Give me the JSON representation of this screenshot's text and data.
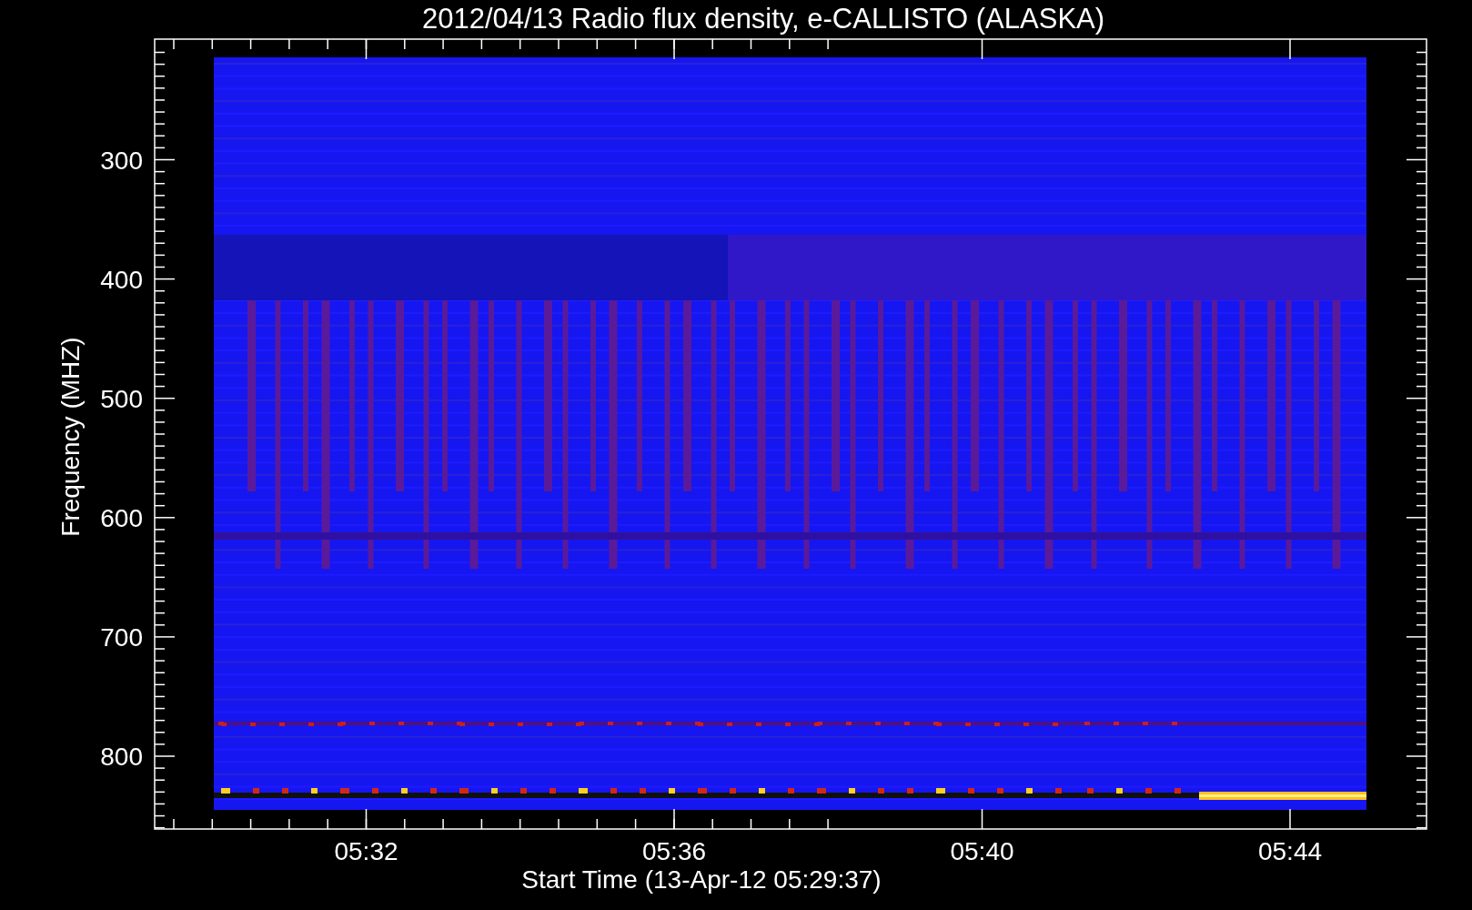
{
  "title": "2012/04/13  Radio flux density, e-CALLISTO (ALASKA)",
  "plot": {
    "ylabel": "Frequency (MHZ)",
    "xlabel": "Start Time (13-Apr-12 05:29:37)",
    "yticks": [
      "300",
      "400",
      "500",
      "600",
      "700",
      "800"
    ],
    "xticks": [
      "05:32",
      "05:36",
      "05:40",
      "05:44"
    ]
  }
}
